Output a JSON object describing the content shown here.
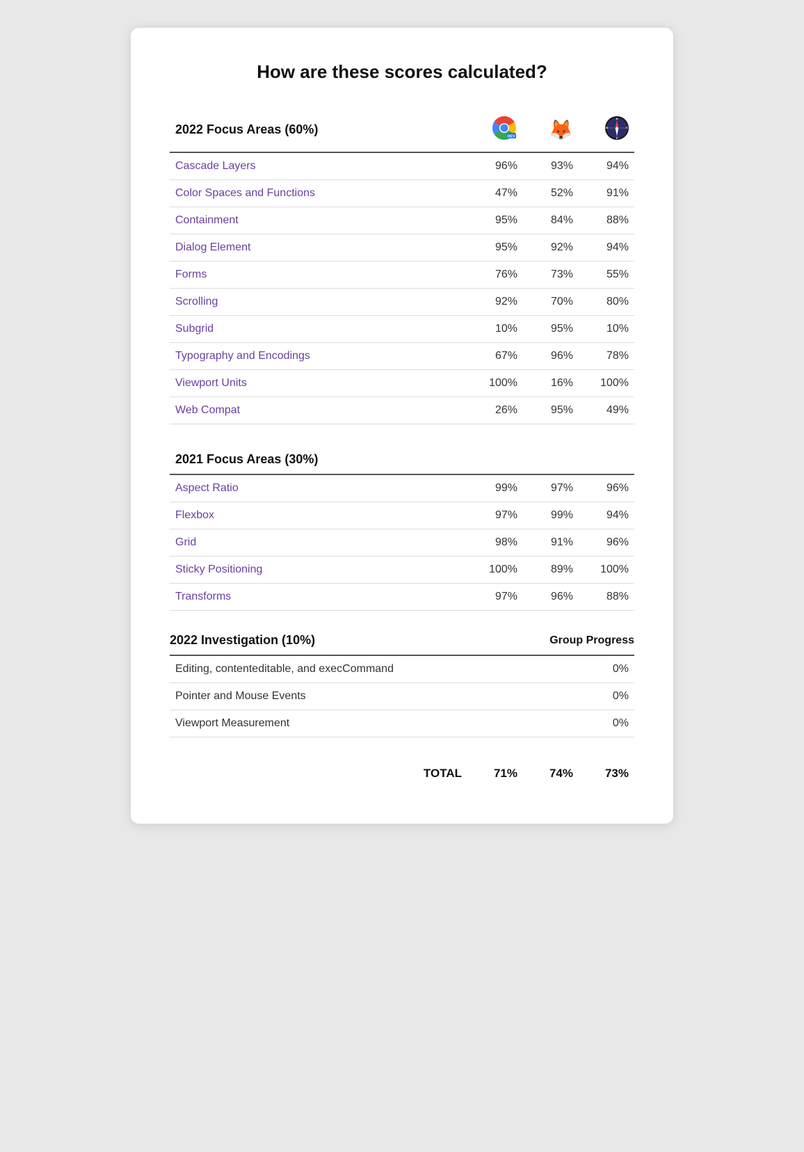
{
  "title": "How are these scores calculated?",
  "sections": {
    "focus2022": {
      "heading": "2022 Focus Areas (60%)",
      "browsers": [
        "chrome-dev",
        "firefox",
        "safari"
      ],
      "rows": [
        {
          "label": "Cascade Layers",
          "scores": [
            "96%",
            "93%",
            "94%"
          ]
        },
        {
          "label": "Color Spaces and Functions",
          "scores": [
            "47%",
            "52%",
            "91%"
          ]
        },
        {
          "label": "Containment",
          "scores": [
            "95%",
            "84%",
            "88%"
          ]
        },
        {
          "label": "Dialog Element",
          "scores": [
            "95%",
            "92%",
            "94%"
          ]
        },
        {
          "label": "Forms",
          "scores": [
            "76%",
            "73%",
            "55%"
          ]
        },
        {
          "label": "Scrolling",
          "scores": [
            "92%",
            "70%",
            "80%"
          ]
        },
        {
          "label": "Subgrid",
          "scores": [
            "10%",
            "95%",
            "10%"
          ]
        },
        {
          "label": "Typography and Encodings",
          "scores": [
            "67%",
            "96%",
            "78%"
          ]
        },
        {
          "label": "Viewport Units",
          "scores": [
            "100%",
            "16%",
            "100%"
          ]
        },
        {
          "label": "Web Compat",
          "scores": [
            "26%",
            "95%",
            "49%"
          ]
        }
      ]
    },
    "focus2021": {
      "heading": "2021 Focus Areas (30%)",
      "rows": [
        {
          "label": "Aspect Ratio",
          "scores": [
            "99%",
            "97%",
            "96%"
          ]
        },
        {
          "label": "Flexbox",
          "scores": [
            "97%",
            "99%",
            "94%"
          ]
        },
        {
          "label": "Grid",
          "scores": [
            "98%",
            "91%",
            "96%"
          ]
        },
        {
          "label": "Sticky Positioning",
          "scores": [
            "100%",
            "89%",
            "100%"
          ]
        },
        {
          "label": "Transforms",
          "scores": [
            "97%",
            "96%",
            "88%"
          ]
        }
      ]
    },
    "investigation2022": {
      "heading": "2022 Investigation (10%)",
      "group_progress_label": "Group Progress",
      "rows": [
        {
          "label": "Editing, contenteditable, and execCommand",
          "score": "0%"
        },
        {
          "label": "Pointer and Mouse Events",
          "score": "0%"
        },
        {
          "label": "Viewport Measurement",
          "score": "0%"
        }
      ]
    },
    "totals": {
      "label": "TOTAL",
      "scores": [
        "71%",
        "74%",
        "73%"
      ]
    }
  }
}
